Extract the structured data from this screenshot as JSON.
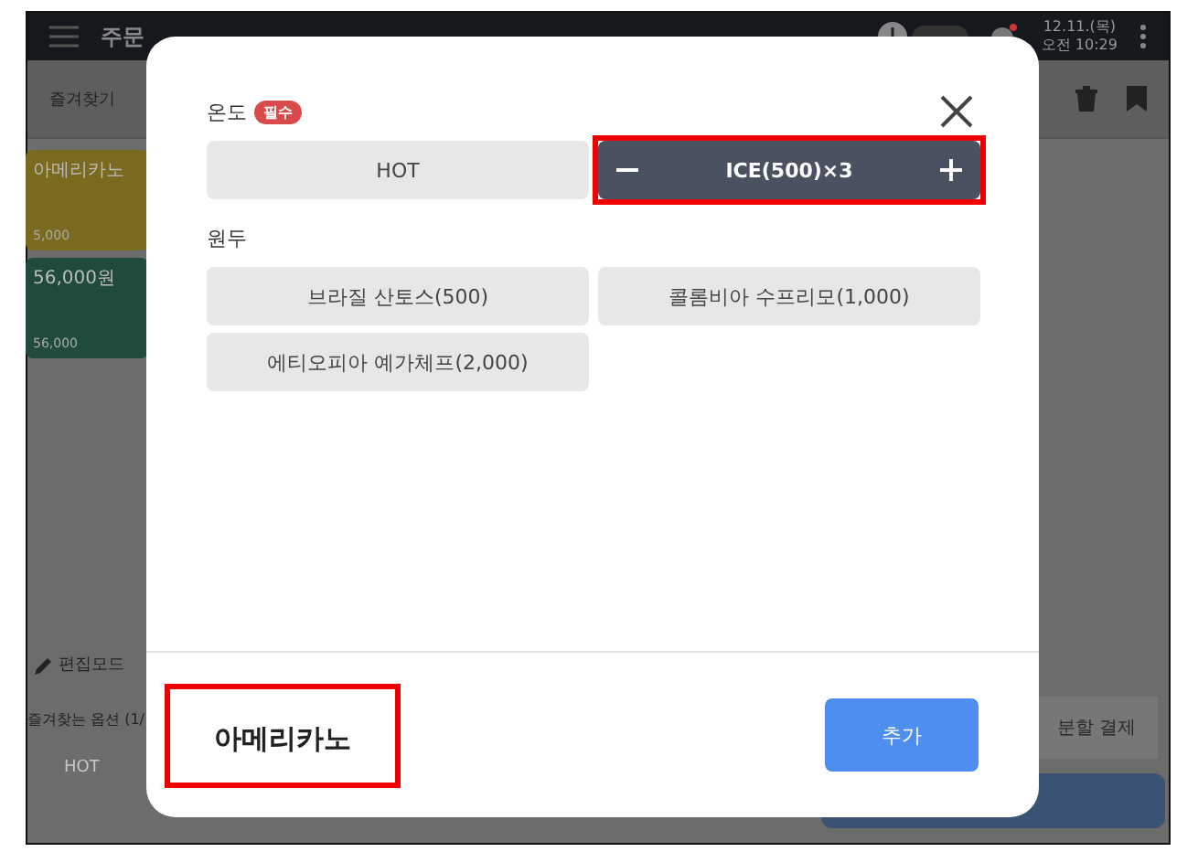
{
  "app_bar": {
    "tabs": [
      {
        "label": "주문",
        "selected": true
      }
    ],
    "toggle_on": false,
    "date": "12.11.(목)",
    "time": "오전 10:29"
  },
  "sub_bar": {
    "tab": "즐겨찾기"
  },
  "menu_cards": [
    {
      "name": "아메리카노",
      "price": "5,000",
      "color": "#7a6a1e"
    },
    {
      "name": "56,000원",
      "price": "56,000",
      "color": "#1f4a3c"
    }
  ],
  "edit_mode": "편집모드",
  "favorite_options": {
    "title": "즐겨찾는 옵션 (1/",
    "option": "HOT"
  },
  "split_payment": "분할 결제",
  "modal": {
    "groups": [
      {
        "title": "온도",
        "badge": "필수",
        "options": [
          {
            "label": "HOT",
            "selected": false,
            "highlighted": false
          },
          {
            "label": "ICE(500)×3",
            "selected": true,
            "highlighted": true
          }
        ]
      },
      {
        "title": "원두",
        "options": [
          {
            "label": "브라질 산토스(500)",
            "selected": false,
            "highlighted": false
          },
          {
            "label": "콜롬비아 수프리모(1,000)",
            "selected": false,
            "highlighted": false
          },
          {
            "label": "에티오피아 예가체프(2,000)",
            "selected": false,
            "highlighted": false
          }
        ]
      }
    ],
    "product_name": "아메리카노",
    "product_highlighted": true,
    "add_button": "추가"
  }
}
